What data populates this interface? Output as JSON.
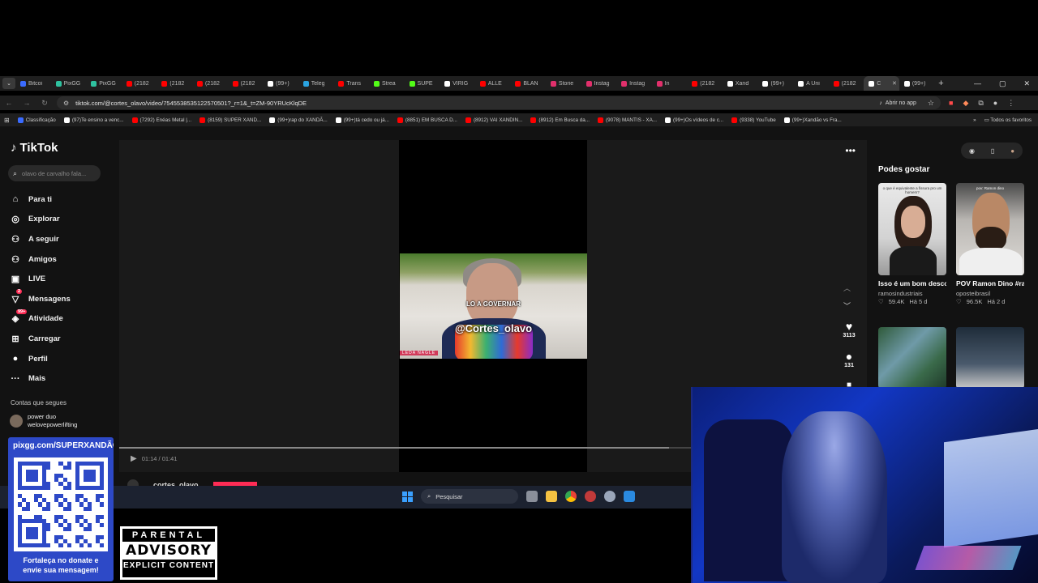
{
  "browser": {
    "tabs": [
      {
        "label": "Bitcoi",
        "color": "#3a6bff"
      },
      {
        "label": "PixGG",
        "color": "#2fc2a0"
      },
      {
        "label": "PixGG",
        "color": "#2fc2a0"
      },
      {
        "label": "(2182",
        "color": "#ff0000"
      },
      {
        "label": "(2182",
        "color": "#ff0000"
      },
      {
        "label": "(2182",
        "color": "#ff0000"
      },
      {
        "label": "(2182",
        "color": "#ff0000"
      },
      {
        "label": "(99+)",
        "color": "#ffffff"
      },
      {
        "label": "Teleg",
        "color": "#2aa3e0"
      },
      {
        "label": "Trans",
        "color": "#ff0000"
      },
      {
        "label": "Strea",
        "color": "#53fc18"
      },
      {
        "label": "SUPE",
        "color": "#53fc18"
      },
      {
        "label": "VIRIG",
        "color": "#ffffff"
      },
      {
        "label": "ALLE",
        "color": "#ff0000"
      },
      {
        "label": "BLAN",
        "color": "#ff0000"
      },
      {
        "label": "Storie",
        "color": "#e1306c"
      },
      {
        "label": "Instag",
        "color": "#e1306c"
      },
      {
        "label": "Instag",
        "color": "#e1306c"
      },
      {
        "label": "In",
        "color": "#e1306c"
      },
      {
        "label": "(2182",
        "color": "#ff0000"
      },
      {
        "label": "Xand",
        "color": "#ffffff"
      },
      {
        "label": "(99+)",
        "color": "#ffffff"
      },
      {
        "label": "A Úni",
        "color": "#ffffff"
      },
      {
        "label": "(2182",
        "color": "#ff0000"
      },
      {
        "label": "C",
        "color": "#ffffff",
        "active": true
      },
      {
        "label": "(99+)",
        "color": "#ffffff"
      }
    ],
    "url": "tiktok.com/@cortes_olavo/video/7545538535122570501?_r=1&_t=ZM-90YRUcKlqDE",
    "open_app": "Abrir no app",
    "bookmarks": [
      {
        "label": "Classificação",
        "color": "#3a6bff"
      },
      {
        "label": "(97)Te ensino a venc...",
        "color": "#ffffff"
      },
      {
        "label": "(7292) Enéas Metal |...",
        "color": "#ff0000"
      },
      {
        "label": "(8159) SUPER XAND...",
        "color": "#ff0000"
      },
      {
        "label": "(99+)rap do XANDÃ...",
        "color": "#ffffff"
      },
      {
        "label": "(99+)tá cedo ou já...",
        "color": "#ffffff"
      },
      {
        "label": "(8851) EM BUSCA D...",
        "color": "#ff0000"
      },
      {
        "label": "(8912) VAI XANDIN...",
        "color": "#ff0000"
      },
      {
        "label": "(8912) Em Busca da...",
        "color": "#ff0000"
      },
      {
        "label": "(9078) MANTIS - XA...",
        "color": "#ff0000"
      },
      {
        "label": "(99+)Os vídeos de c...",
        "color": "#ffffff"
      },
      {
        "label": "(9338) YouTube",
        "color": "#ff0000"
      },
      {
        "label": "(99+)Xandão vs Fra...",
        "color": "#ffffff"
      }
    ],
    "all_bookmarks": "Todos os favoritos"
  },
  "tiktok": {
    "logo": "TikTok",
    "search_placeholder": "olavo de carvalho fala...",
    "nav": [
      {
        "label": "Para ti",
        "icon": "home-icon",
        "glyph": "⌂"
      },
      {
        "label": "Explorar",
        "icon": "compass-icon",
        "glyph": "◎"
      },
      {
        "label": "A seguir",
        "icon": "following-icon",
        "glyph": "⚇"
      },
      {
        "label": "Amigos",
        "icon": "friends-icon",
        "glyph": "⚇"
      },
      {
        "label": "LIVE",
        "icon": "live-icon",
        "glyph": "▣"
      },
      {
        "label": "Mensagens",
        "icon": "messages-icon",
        "glyph": "▽",
        "badge": "2"
      },
      {
        "label": "Atividade",
        "icon": "activity-icon",
        "glyph": "◈",
        "badge": "99+"
      },
      {
        "label": "Carregar",
        "icon": "upload-icon",
        "glyph": "⊞"
      },
      {
        "label": "Perfil",
        "icon": "profile-icon",
        "glyph": "●"
      },
      {
        "label": "Mais",
        "icon": "more-icon",
        "glyph": "···"
      }
    ],
    "following_header": "Contas que segues",
    "following_user": {
      "name": "power duo",
      "handle": "welovepowerlifting"
    },
    "video": {
      "caption_top": "LO A GOVERNAR",
      "caption_main": "@Cortes_olavo",
      "name_tag": "LEDA NAGLE",
      "time": "01:14 / 01:41",
      "progress": 0.735,
      "author": "cortes_olavo",
      "likes": "3113",
      "comments": "131"
    },
    "recommendations_title": "Podes gostar",
    "recommendations": [
      {
        "title": "Isso é um bom desconto na compr...",
        "user": "ramosindustriais",
        "views": "59.4K",
        "ago": "Há 5 d",
        "thumb_text": "o que é equivalente a fissura pro um homem?"
      },
      {
        "title": "POV Ramon Dino #ramondino...",
        "user": "oposteibrasil",
        "views": "96.5K",
        "ago": "Há 2 d",
        "thumb_text": "pov: Ramon dino"
      }
    ]
  },
  "taskbar": {
    "search": "Pesquisar"
  },
  "overlay": {
    "donate_url": "pixgg.com/SUPERXANDÃO",
    "donate_caption_1": "Fortaleça no donate e",
    "donate_caption_2": "envie sua mensagem!",
    "advisory_1": "PARENTAL",
    "advisory_2": "ADVISORY",
    "advisory_3": "EXPLICIT CONTENT"
  }
}
